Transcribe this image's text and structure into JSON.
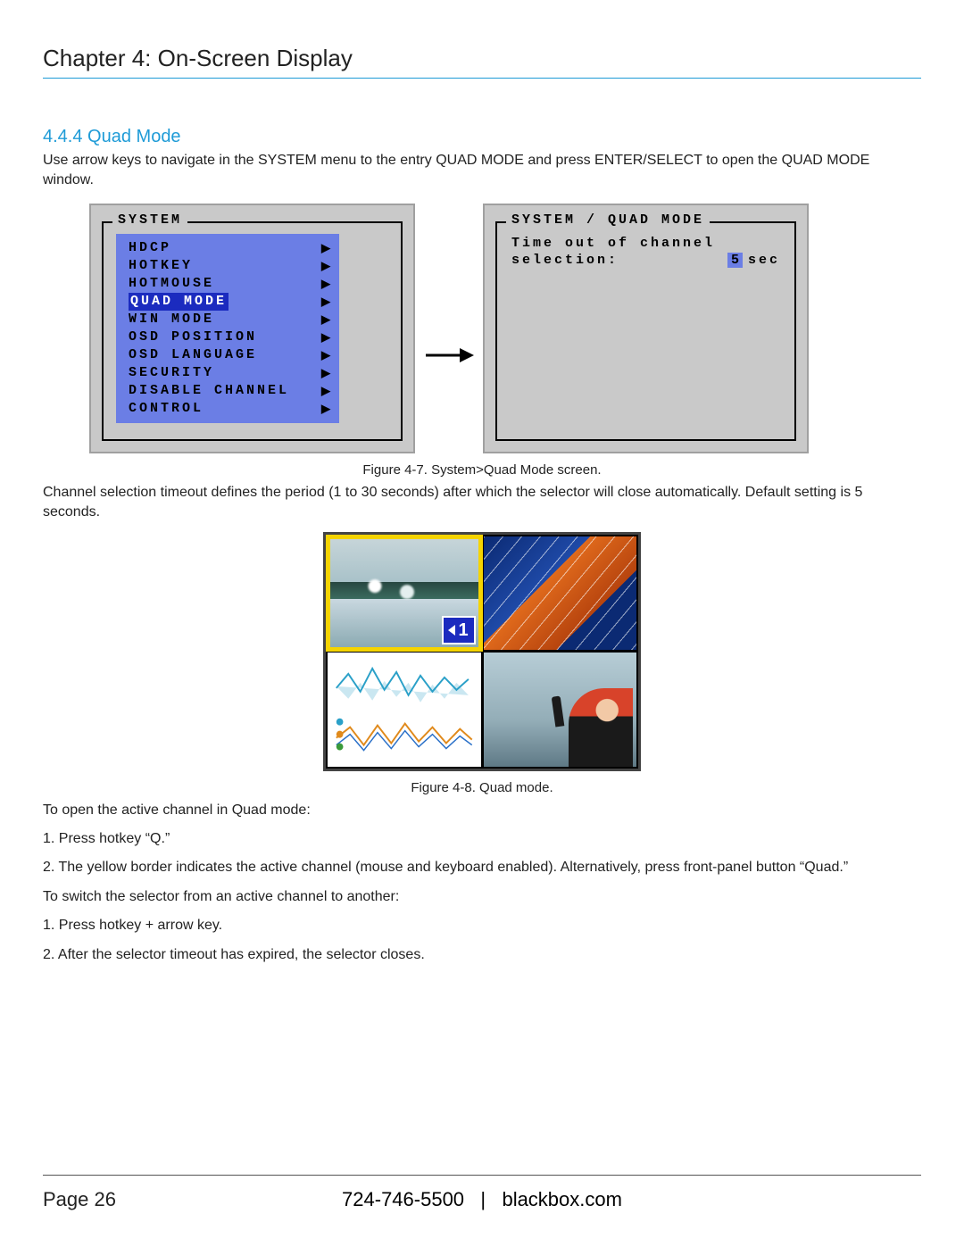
{
  "chapter_title": "Chapter 4: On-Screen Display",
  "section": {
    "number": "4.4.4",
    "title": "Quad Mode",
    "intro": "Use arrow keys to navigate in the SYSTEM menu to the entry QUAD MODE and press ENTER/SELECT to open the QUAD MODE window."
  },
  "system_menu": {
    "tab": "SYSTEM",
    "items": [
      {
        "label": "HDCP",
        "selected": false
      },
      {
        "label": "HOTKEY",
        "selected": false
      },
      {
        "label": "HOTMOUSE",
        "selected": false
      },
      {
        "label": "QUAD MODE",
        "selected": true
      },
      {
        "label": "WIN MODE",
        "selected": false
      },
      {
        "label": "OSD POSITION",
        "selected": false
      },
      {
        "label": "OSD LANGUAGE",
        "selected": false
      },
      {
        "label": "SECURITY",
        "selected": false
      },
      {
        "label": "DISABLE CHANNEL",
        "selected": false
      },
      {
        "label": "CONTROL",
        "selected": false
      }
    ]
  },
  "quad_menu": {
    "tab": "SYSTEM / QUAD MODE",
    "line1": "Time out of channel",
    "line2_label": "selection:",
    "value": "5",
    "unit": "sec"
  },
  "fig1_caption": "Figure 4-7. System>Quad Mode screen.",
  "timeout_para": "Channel selection timeout defines the period (1 to 30 seconds) after which the selector will close automatically. Default setting is 5 seconds.",
  "quad_badge": "1",
  "fig2_caption": "Figure 4-8. Quad mode.",
  "instructions": [
    "To open the active channel in Quad mode:",
    "1. Press hotkey “Q.”",
    "2. The yellow border indicates the active channel (mouse and keyboard enabled). Alternatively, press front-panel button “Quad.”",
    "To switch the selector from an active channel to another:",
    "1. Press hotkey + arrow key.",
    "2. After the selector timeout has expired, the selector closes."
  ],
  "footer": {
    "page": "Page 26",
    "phone": "724-746-5500",
    "sep": "|",
    "site": "blackbox.com"
  }
}
